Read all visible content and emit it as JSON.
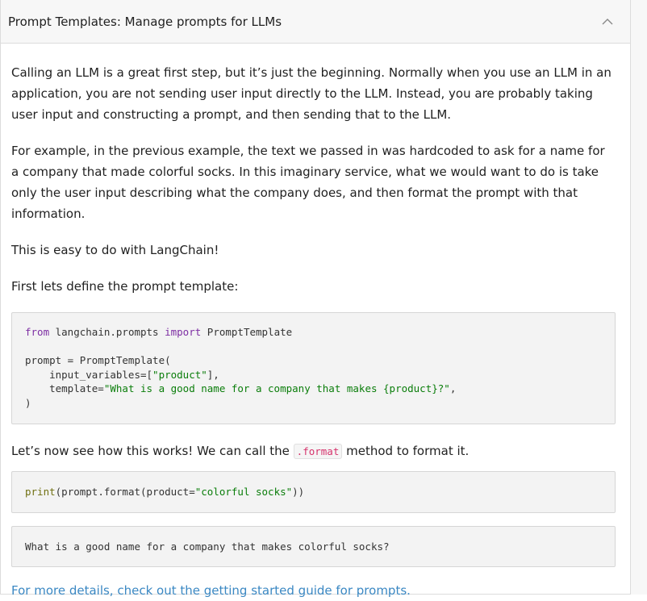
{
  "header": {
    "title": "Prompt Templates: Manage prompts for LLMs",
    "toggle_icon": "chevron-up-icon"
  },
  "content": {
    "paragraph_1": "Calling an LLM is a great first step, but it’s just the beginning. Normally when you use an LLM in an application, you are not sending user input directly to the LLM. Instead, you are probably taking user input and constructing a prompt, and then sending that to the LLM.",
    "paragraph_2": "For example, in the previous example, the text we passed in was hardcoded to ask for a name for a company that made colorful socks. In this imaginary service, what we would want to do is take only the user input describing what the company does, and then format the prompt with that information.",
    "paragraph_3": "This is easy to do with LangChain!",
    "paragraph_4": "First lets define the prompt template:",
    "code_block_1": {
      "line1": {
        "kw1": "from",
        "module": " langchain.prompts ",
        "kw2": "import",
        "name": " PromptTemplate"
      },
      "line3": "prompt = PromptTemplate(",
      "line4": {
        "pre": "    input_variables=[",
        "str": "\"product\"",
        "post": "],"
      },
      "line5": {
        "pre": "    template=",
        "str": "\"What is a good name for a company that makes {product}?\"",
        "post": ","
      },
      "line6": ")"
    },
    "paragraph_5": {
      "before": "Let’s now see how this works! We can call the ",
      "code": ".format",
      "after": " method to format it."
    },
    "code_block_2": {
      "fn": "print",
      "pre": "(prompt.format(product=",
      "str": "\"colorful socks\"",
      "post": "))"
    },
    "output_block": "What is a good name for a company that makes colorful socks?",
    "footer_link": "For more details, check out the getting started guide for prompts."
  }
}
